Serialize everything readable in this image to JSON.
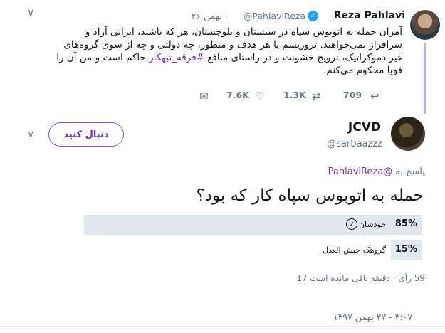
{
  "quoted_tweet": {
    "author_name": "Reza Pahlavi",
    "handle": "@PahlaviReza",
    "date": "· بهمن ۲۶",
    "text_lines": [
      "آمران حمله به اتوبوس سپاه در سیستان و بلوچستان، هر که باشند، ایرانی آزاد و",
      "سرافراز نمی‌خواهند. تروریسم با هر هدف و منظور، چه دولتی و چه از سوی گروه‌های",
      "غیر دموکراتیک، ترویج خشونت و در راستای منافع #فرقه_تبهکار حاکم است و من آن را",
      "قویا محکوم می‌کنم."
    ],
    "replies": "709",
    "retweets": "1.3K",
    "likes": "7.6K"
  },
  "reply_tweet": {
    "author_name": "JCVD",
    "handle": "@sarbaazzz",
    "follow_label": "دنبال کنید",
    "replying_to_prefix": "پاسخ به",
    "replying_to_handle": "@PahlaviReza",
    "question": "حمله به اتوبوس سپاه کار که بود؟",
    "poll": {
      "options": [
        {
          "label": "خودشان",
          "percent": "85%",
          "share": 0.85,
          "winner": true
        },
        {
          "label": "گروهک جیش العدل",
          "percent": "15%",
          "share": 0.15,
          "winner": false
        }
      ],
      "votes": "59 رأی",
      "time_left": "دقیقه باقی مانده است 17",
      "separator": "·"
    },
    "timestamp": "۳:۰۷ - ۲۷ بهمن ۱۳۹۷"
  },
  "icons": {
    "verified": "verified-badge-icon",
    "reply": "reply-icon",
    "retweet": "retweet-icon",
    "like": "heart-icon",
    "dm": "envelope-icon",
    "menu": "chevron-down-icon",
    "check": "check-circle-icon"
  },
  "colors": {
    "accent": "#6b2fb3",
    "thread_line": "#c4a6e8",
    "verified": "#1da1f2",
    "poll_bar": "#e1e8ed",
    "muted_text": "#657786"
  }
}
